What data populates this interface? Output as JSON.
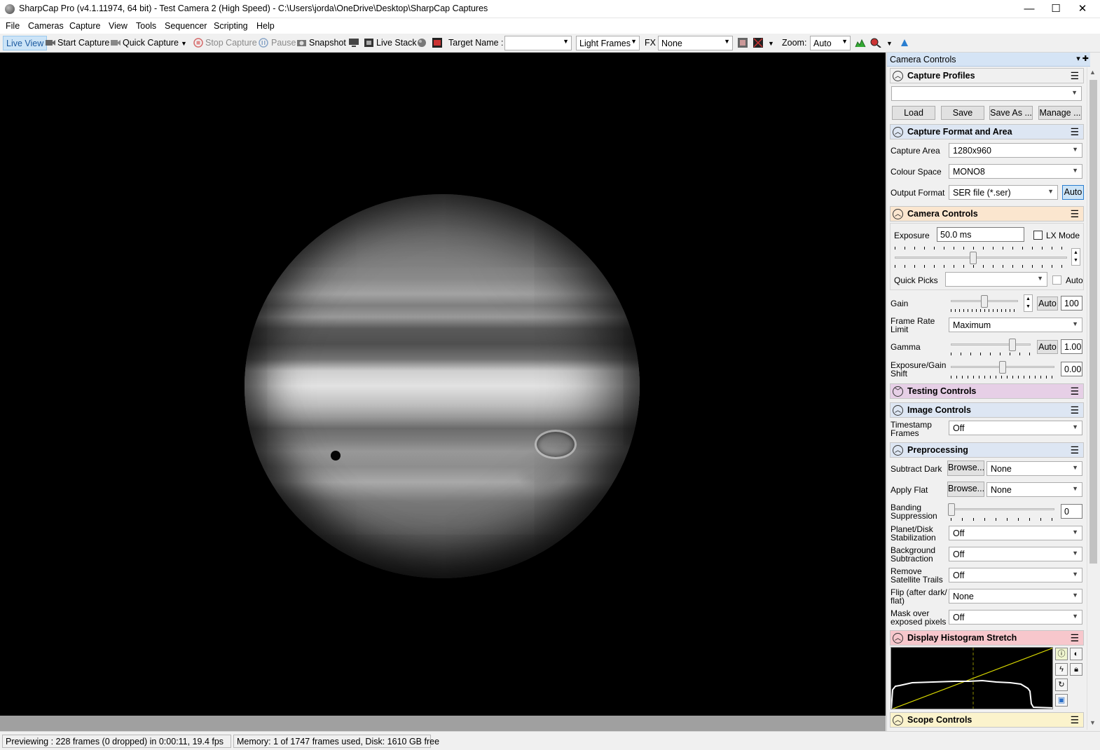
{
  "window": {
    "title": "SharpCap Pro (v4.1.11974, 64 bit) - Test Camera 2 (High Speed) - C:\\Users\\jorda\\OneDrive\\Desktop\\SharpCap Captures",
    "minimize": "—",
    "maximize": "☐",
    "close": "✕"
  },
  "menu": [
    "File",
    "Cameras",
    "Capture",
    "View",
    "Tools",
    "Sequencer",
    "Scripting",
    "Help"
  ],
  "toolbar": {
    "live_view": "Live View",
    "start_capture": "Start Capture",
    "quick_capture": "Quick Capture",
    "stop_capture": "Stop Capture",
    "pause": "Pause",
    "snapshot": "Snapshot",
    "live_stack": "Live Stack",
    "target_name_label": "Target Name :",
    "target_name_value": "",
    "frame_type": "Light Frames",
    "fx_label": "FX",
    "fx_value": "None",
    "zoom_label": "Zoom:",
    "zoom_value": "Auto"
  },
  "panel": {
    "title": "Camera Controls",
    "capture_profiles": {
      "header": "Capture Profiles",
      "profile_value": "",
      "load": "Load",
      "save": "Save",
      "save_as": "Save As ...",
      "manage": "Manage ..."
    },
    "capture_format": {
      "header": "Capture Format and Area",
      "capture_area_label": "Capture Area",
      "capture_area_value": "1280x960",
      "colour_space_label": "Colour Space",
      "colour_space_value": "MONO8",
      "output_format_label": "Output Format",
      "output_format_value": "SER file (*.ser)",
      "auto": "Auto"
    },
    "camera_controls": {
      "header": "Camera Controls",
      "exposure_label": "Exposure",
      "exposure_value": "50.0 ms",
      "lx_mode": "LX Mode",
      "quick_picks_label": "Quick Picks",
      "quick_picks_value": "",
      "auto": "Auto",
      "gain_label": "Gain",
      "gain_auto": "Auto",
      "gain_value": "100",
      "frame_rate_label": "Frame Rate Limit",
      "frame_rate_value": "Maximum",
      "gamma_label": "Gamma",
      "gamma_auto": "Auto",
      "gamma_value": "1.00",
      "shift_label": "Exposure/Gain Shift",
      "shift_value": "0.00"
    },
    "testing_controls": {
      "header": "Testing Controls"
    },
    "image_controls": {
      "header": "Image Controls",
      "timestamp_label": "Timestamp Frames",
      "timestamp_value": "Off"
    },
    "preprocessing": {
      "header": "Preprocessing",
      "subtract_dark_label": "Subtract Dark",
      "browse": "Browse...",
      "subtract_dark_value": "None",
      "apply_flat_label": "Apply Flat",
      "apply_flat_value": "None",
      "banding_label": "Banding Suppression",
      "banding_value": "0",
      "stabilization_label": "Planet/Disk Stabilization",
      "stabilization_value": "Off",
      "background_label": "Background Subtraction",
      "background_value": "Off",
      "satellite_label": "Remove Satellite Trails",
      "satellite_value": "Off",
      "flip_label": "Flip (after dark/ flat)",
      "flip_value": "None",
      "mask_label": "Mask over exposed pixels",
      "mask_value": "Off"
    },
    "histogram": {
      "header": "Display Histogram Stretch"
    },
    "scope_controls": {
      "header": "Scope Controls"
    }
  },
  "status": {
    "preview": "Previewing : 228 frames (0 dropped) in 0:00:11, 19.4 fps",
    "memory": "Memory: 1 of 1747 frames used, Disk: 1610 GB free"
  },
  "colors": {
    "capture_format_header": "#dde6f3",
    "camera_controls_header": "#fbe6cf",
    "testing_controls_header": "#e6cfe6",
    "image_controls_header": "#dde6f3",
    "preprocessing_header": "#dde6f3",
    "histogram_header": "#f7c7cc",
    "scope_controls_header": "#fbf3cc"
  }
}
